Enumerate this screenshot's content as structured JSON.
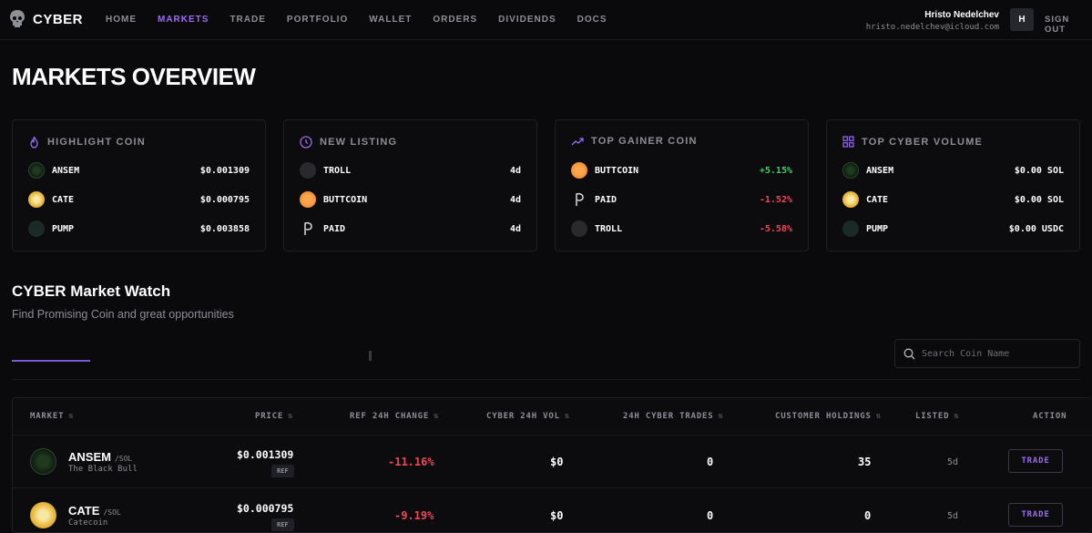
{
  "nav": {
    "brand": "CYBER",
    "links": [
      "HOME",
      "MARKETS",
      "TRADE",
      "PORTFOLIO",
      "WALLET",
      "ORDERS",
      "DIVIDENDS",
      "DOCS"
    ],
    "active": "MARKETS",
    "user_name": "Hristo Nedelchev",
    "user_email": "hristo.nedelchev@icloud.com",
    "avatar_initial": "H",
    "signout": "SIGN OUT"
  },
  "page_title": "MARKETS OVERVIEW",
  "cards": [
    {
      "title": "HIGHLIGHT COIN",
      "icon": "flame-icon",
      "rows": [
        {
          "name": "ANSEM",
          "value": "$0.001309",
          "icon": "ansem"
        },
        {
          "name": "CATE",
          "value": "$0.000795",
          "icon": "cate"
        },
        {
          "name": "PUMP",
          "value": "$0.003858",
          "icon": "pump"
        }
      ]
    },
    {
      "title": "NEW LISTING",
      "icon": "clock-icon",
      "rows": [
        {
          "name": "TROLL",
          "value": "4d",
          "icon": "troll"
        },
        {
          "name": "BUTTCOIN",
          "value": "4d",
          "icon": "butt"
        },
        {
          "name": "PAID",
          "value": "4d",
          "icon": "paid"
        }
      ]
    },
    {
      "title": "TOP GAINER COIN",
      "icon": "trend-up-icon",
      "rows": [
        {
          "name": "BUTTCOIN",
          "value": "+5.15%",
          "icon": "butt",
          "tone": "pos"
        },
        {
          "name": "PAID",
          "value": "-1.52%",
          "icon": "paid",
          "tone": "neg"
        },
        {
          "name": "TROLL",
          "value": "-5.58%",
          "icon": "troll",
          "tone": "neg"
        }
      ]
    },
    {
      "title": "TOP CYBER VOLUME",
      "icon": "grid-icon",
      "rows": [
        {
          "name": "ANSEM",
          "value": "$0.00 SOL",
          "icon": "ansem"
        },
        {
          "name": "CATE",
          "value": "$0.00 SOL",
          "icon": "cate"
        },
        {
          "name": "PUMP",
          "value": "$0.00 USDC",
          "icon": "pump"
        }
      ]
    }
  ],
  "watch": {
    "title": "CYBER Market Watch",
    "subtitle": "Find Promising Coin and great opportunities",
    "search_placeholder": "Search Coin Name"
  },
  "table": {
    "headers": [
      "MARKET",
      "PRICE",
      "REF 24H CHANGE",
      "CYBER 24H VOL",
      "24H CYBER TRADES",
      "CUSTOMER HOLDINGS",
      "LISTED",
      "ACTION"
    ],
    "rows": [
      {
        "symbol": "ANSEM",
        "pair": "/SOL",
        "full": "The Black Bull",
        "price": "$0.001309",
        "ref": "REF",
        "change": "-11.16%",
        "vol": "$0",
        "trades": "0",
        "holdings": "35",
        "listed": "5d",
        "action": "TRADE",
        "icon": "ansem"
      },
      {
        "symbol": "CATE",
        "pair": "/SOL",
        "full": "Catecoin",
        "price": "$0.000795",
        "ref": "REF",
        "change": "-9.19%",
        "vol": "$0",
        "trades": "0",
        "holdings": "0",
        "listed": "5d",
        "action": "TRADE",
        "icon": "cate"
      }
    ]
  },
  "colors": {
    "accent": "#9b6cf0",
    "positive": "#3fce6a",
    "negative": "#f0465a",
    "background": "#0a0a0c"
  }
}
